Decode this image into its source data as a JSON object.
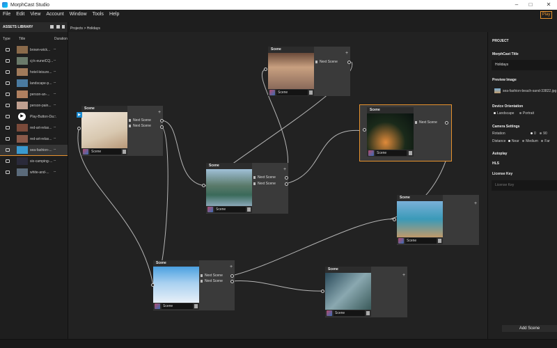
{
  "window": {
    "title": "MorphCast Studio"
  },
  "menu": [
    "File",
    "Edit",
    "View",
    "Account",
    "Window",
    "Tools",
    "Help"
  ],
  "toolbar": {
    "play_label": "Play"
  },
  "assets": {
    "header": "ASSETS LIBRARY",
    "columns": {
      "type": "Type",
      "title": "Title",
      "duration": "Duration"
    },
    "items": [
      {
        "title": "brown-wick...",
        "duration": "--",
        "color": "#8a6a4a"
      },
      {
        "title": "cj-k-euneiCQ...",
        "duration": "--",
        "color": "#6a7a6a"
      },
      {
        "title": "hotel-leisure...",
        "duration": "--",
        "color": "#a07a5a"
      },
      {
        "title": "landscape-p...",
        "duration": "--",
        "color": "#4a7aa0"
      },
      {
        "title": "person-an-...",
        "duration": "--",
        "color": "#b08060"
      },
      {
        "title": "person-pain...",
        "duration": "--",
        "color": "#c0a090"
      },
      {
        "title": "Play-Button-Da...",
        "duration": "--",
        "color": "#ffffff",
        "icon": "play-icon"
      },
      {
        "title": "red-art-relax...",
        "duration": "--",
        "color": "#7a4a3a"
      },
      {
        "title": "red-art-relax...",
        "duration": "--",
        "color": "#8a5a4a"
      },
      {
        "title": "sea-fashion-...",
        "duration": "--",
        "color": "#3a9ad0",
        "selected": true
      },
      {
        "title": "six-camping-...",
        "duration": "--",
        "color": "#2a2a3a"
      },
      {
        "title": "white-and-...",
        "duration": "--",
        "color": "#5a6a7a"
      }
    ]
  },
  "breadcrumb": "Projects > Holidays",
  "nodes": [
    {
      "id": "n1",
      "header": "Scene",
      "scene_name": "Scene",
      "outputs": [
        "Next Scene",
        "Next Scene"
      ],
      "image": "linear-gradient(160deg,#f0e6da,#d8c8b0 60%,#b89878)"
    },
    {
      "id": "n2",
      "header": "Scene",
      "scene_name": "Scene",
      "outputs": [
        "Next Scene"
      ],
      "image": "linear-gradient(180deg,#6a4a3a,#c8a080 40%,#8a6a5a)"
    },
    {
      "id": "n3",
      "header": "Scene",
      "scene_name": "Scene",
      "outputs": [
        "Next Scene",
        "Next Scene"
      ],
      "image": "linear-gradient(180deg,#a0c0d8,#5a7a6a 45%,#3a6a5a 70%,#8aa8b8)"
    },
    {
      "id": "n4",
      "header": "Scene",
      "scene_name": "Scene",
      "outputs": [
        "Next Scene"
      ],
      "image": "radial-gradient(ellipse at 40% 80%,#e08a3a,#1a2a1a 50%,#0a1210)"
    },
    {
      "id": "n5",
      "header": "Scene",
      "scene_name": "Scene",
      "outputs": [],
      "image": "linear-gradient(180deg,#7ab0d8,#3a9ab8 50%,#c09a6a)"
    },
    {
      "id": "n6",
      "header": "Scene",
      "scene_name": "Scene",
      "outputs": [
        "Next Scene",
        "Next Scene"
      ],
      "image": "linear-gradient(180deg,#4aa0e0,#a8d0f0 45%,#e8f0f8)"
    },
    {
      "id": "n7",
      "header": "Scene",
      "scene_name": "Scene",
      "outputs": [],
      "image": "linear-gradient(135deg,#2a4a5a,#8aa8b0 50%,#3a5a5a)"
    }
  ],
  "project": {
    "section": "PROJECT",
    "title_label": "MorphCast Title",
    "title_value": "Holidays",
    "preview_label": "Preview Image",
    "preview_value": "sea-fashion-beach-sand-33822.jpg",
    "orientation_label": "Device Orientation",
    "orientation_options": [
      "Landscape",
      "Portrait"
    ],
    "camera_label": "Camera Settings",
    "rotation_label": "Rotation",
    "rotation_options": [
      "0",
      "90"
    ],
    "distance_label": "Distance",
    "distance_options": [
      "Near",
      "Medium",
      "Far"
    ],
    "autoplay_label": "Autoplay",
    "hls_label": "HLS",
    "license_label": "License Key",
    "license_placeholder": "License Key",
    "add_scene_label": "Add Scene"
  },
  "colors": {
    "accent": "#e8932e",
    "canvas": "#222222",
    "node": "#3a3a3a"
  }
}
